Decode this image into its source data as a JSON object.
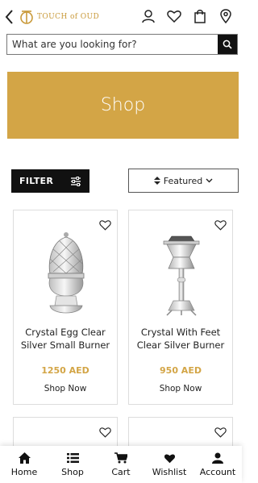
{
  "header": {
    "brand": "TOUCH of OUD",
    "brand_color": "#c99a3a",
    "icons": [
      "account-icon",
      "heart-icon",
      "bag-icon",
      "location-icon"
    ]
  },
  "search": {
    "placeholder": "What are you looking for?"
  },
  "banner": {
    "title": "Shop",
    "color": "#d3a546"
  },
  "toolbar": {
    "filter_label": "FILTER",
    "sort_label": "Featured"
  },
  "products": [
    {
      "name": "Crystal Egg Clear Silver Small Burner",
      "price": "1250 AED",
      "cta": "Shop Now"
    },
    {
      "name": "Crystal With Feet Clear Silver Burner",
      "price": "950 AED",
      "cta": "Shop Now"
    }
  ],
  "bottom_nav": [
    {
      "label": "Home",
      "icon": "home-icon"
    },
    {
      "label": "Shop",
      "icon": "list-icon"
    },
    {
      "label": "Cart",
      "icon": "cart-icon"
    },
    {
      "label": "Wishlist",
      "icon": "heart-icon"
    },
    {
      "label": "Account",
      "icon": "user-icon"
    }
  ]
}
